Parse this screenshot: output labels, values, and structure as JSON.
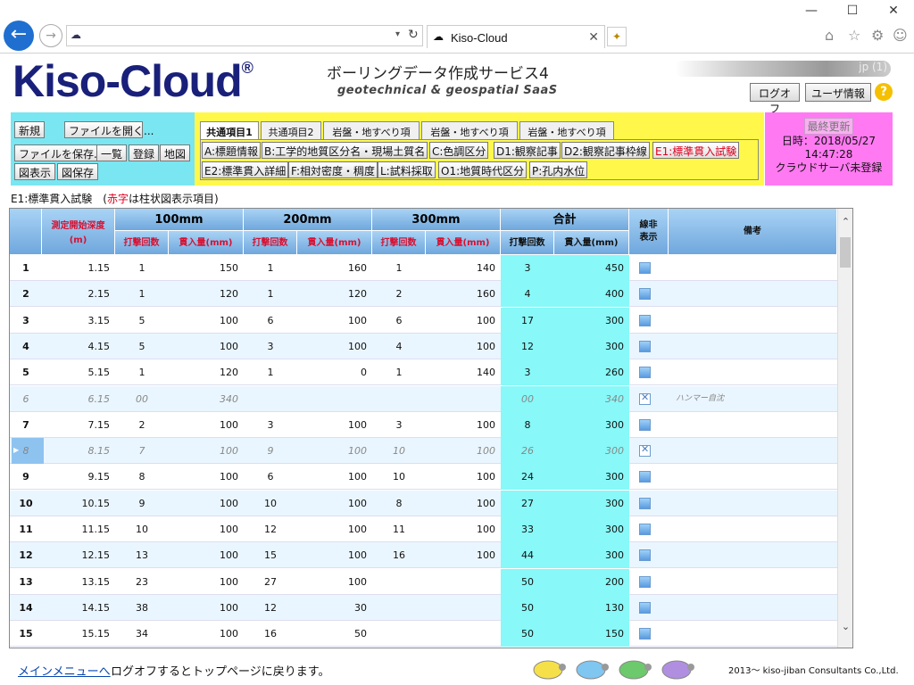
{
  "browser": {
    "tab_title": "Kiso-Cloud",
    "window_min": "—",
    "window_max": "☐",
    "window_close": "✕"
  },
  "header": {
    "logo": "Kiso-Cloud",
    "logo_mark": "®",
    "subtitle": "ボーリングデータ作成サービス4",
    "tagline": "geotechnical & geospatial SaaS",
    "user_text": "jp (1)",
    "logout_label": "ログオフ",
    "userinfo_label": "ユーザ情報",
    "help_label": "?"
  },
  "toolbar": {
    "new_label": "新規",
    "open_label": "ファイルを開く...",
    "save_label": "ファイルを保存...",
    "list_label": "一覧",
    "register_label": "登録",
    "map_label": "地図",
    "chart_label": "図表示",
    "chart_save_label": "図保存",
    "tabs": [
      "共通項目1",
      "共通項目2",
      "岩盤・地すべり項目1",
      "岩盤・地すべり項目2",
      "岩盤・地すべり項目3"
    ],
    "sections": [
      "A:標題情報",
      "B:工学的地質区分名・現場土質名",
      "C:色調区分",
      "D1:観察記事",
      "D2:観察記事枠線",
      "E1:標準貫入試験",
      "E2:標準貫入詳細",
      "F:相対密度・稠度",
      "L:試料採取",
      "O1:地質時代区分",
      "P:孔内水位"
    ],
    "update": {
      "button": "最終更新",
      "date_line": "日時：2018/05/27",
      "time_line": "14:47:28",
      "status_line": "クラウドサーバ未登録"
    }
  },
  "section": {
    "title_prefix": "E1:標準貫入試験　(",
    "title_red": "赤字",
    "title_suffix": "は柱状図表示項目)"
  },
  "grid": {
    "headers": {
      "depth": "測定開始深度",
      "depth_unit": "(m)",
      "g100": "100mm",
      "g200": "200mm",
      "g300": "300mm",
      "total": "合計",
      "hide": "表示",
      "hide_top": "非",
      "hide_pre": "線",
      "note": "備考",
      "blows": "打撃回数",
      "pen": "貫入量(mm)"
    },
    "rows": [
      {
        "no": "1",
        "depth": "1.15",
        "b1": "1",
        "p1": "150",
        "b2": "1",
        "p2": "160",
        "b3": "1",
        "p3": "140",
        "bt": "3",
        "pt": "450",
        "hidden": false,
        "note": "",
        "dim": false
      },
      {
        "no": "2",
        "depth": "2.15",
        "b1": "1",
        "p1": "120",
        "b2": "1",
        "p2": "120",
        "b3": "2",
        "p3": "160",
        "bt": "4",
        "pt": "400",
        "hidden": false,
        "note": "",
        "dim": false
      },
      {
        "no": "3",
        "depth": "3.15",
        "b1": "5",
        "p1": "100",
        "b2": "6",
        "p2": "100",
        "b3": "6",
        "p3": "100",
        "bt": "17",
        "pt": "300",
        "hidden": false,
        "note": "",
        "dim": false
      },
      {
        "no": "4",
        "depth": "4.15",
        "b1": "5",
        "p1": "100",
        "b2": "3",
        "p2": "100",
        "b3": "4",
        "p3": "100",
        "bt": "12",
        "pt": "300",
        "hidden": false,
        "note": "",
        "dim": false
      },
      {
        "no": "5",
        "depth": "5.15",
        "b1": "1",
        "p1": "120",
        "b2": "1",
        "p2": "0",
        "b3": "1",
        "p3": "140",
        "bt": "3",
        "pt": "260",
        "hidden": false,
        "note": "",
        "dim": false
      },
      {
        "no": "6",
        "depth": "6.15",
        "b1": "00",
        "p1": "340",
        "b2": "",
        "p2": "",
        "b3": "",
        "p3": "",
        "bt": "00",
        "pt": "340",
        "hidden": true,
        "note": "ハンマー自沈",
        "dim": true
      },
      {
        "no": "7",
        "depth": "7.15",
        "b1": "2",
        "p1": "100",
        "b2": "3",
        "p2": "100",
        "b3": "3",
        "p3": "100",
        "bt": "8",
        "pt": "300",
        "hidden": false,
        "note": "",
        "dim": false
      },
      {
        "no": "8",
        "depth": "8.15",
        "b1": "7",
        "p1": "100",
        "b2": "9",
        "p2": "100",
        "b3": "10",
        "p3": "100",
        "bt": "26",
        "pt": "300",
        "hidden": true,
        "note": "",
        "dim": true
      },
      {
        "no": "9",
        "depth": "9.15",
        "b1": "8",
        "p1": "100",
        "b2": "6",
        "p2": "100",
        "b3": "10",
        "p3": "100",
        "bt": "24",
        "pt": "300",
        "hidden": false,
        "note": "",
        "dim": false
      },
      {
        "no": "10",
        "depth": "10.15",
        "b1": "9",
        "p1": "100",
        "b2": "10",
        "p2": "100",
        "b3": "8",
        "p3": "100",
        "bt": "27",
        "pt": "300",
        "hidden": false,
        "note": "",
        "dim": false
      },
      {
        "no": "11",
        "depth": "11.15",
        "b1": "10",
        "p1": "100",
        "b2": "12",
        "p2": "100",
        "b3": "11",
        "p3": "100",
        "bt": "33",
        "pt": "300",
        "hidden": false,
        "note": "",
        "dim": false
      },
      {
        "no": "12",
        "depth": "12.15",
        "b1": "13",
        "p1": "100",
        "b2": "15",
        "p2": "100",
        "b3": "16",
        "p3": "100",
        "bt": "44",
        "pt": "300",
        "hidden": false,
        "note": "",
        "dim": false
      },
      {
        "no": "13",
        "depth": "13.15",
        "b1": "23",
        "p1": "100",
        "b2": "27",
        "p2": "100",
        "b3": "",
        "p3": "",
        "bt": "50",
        "pt": "200",
        "hidden": false,
        "note": "",
        "dim": false
      },
      {
        "no": "14",
        "depth": "14.15",
        "b1": "38",
        "p1": "100",
        "b2": "12",
        "p2": "30",
        "b3": "",
        "p3": "",
        "bt": "50",
        "pt": "130",
        "hidden": false,
        "note": "",
        "dim": false
      },
      {
        "no": "15",
        "depth": "15.15",
        "b1": "34",
        "p1": "100",
        "b2": "16",
        "p2": "50",
        "b3": "",
        "p3": "",
        "bt": "50",
        "pt": "150",
        "hidden": false,
        "note": "",
        "dim": false
      }
    ]
  },
  "footer": {
    "link": "メインメニューへ",
    "text": "ログオフするとトップページに戻ります。",
    "copyright": "2013～ kiso-jiban Consultants Co.,Ltd.",
    "turtle_colors": [
      "#f6e04a",
      "#7fc6f0",
      "#6cc96c",
      "#b08fe0"
    ]
  }
}
